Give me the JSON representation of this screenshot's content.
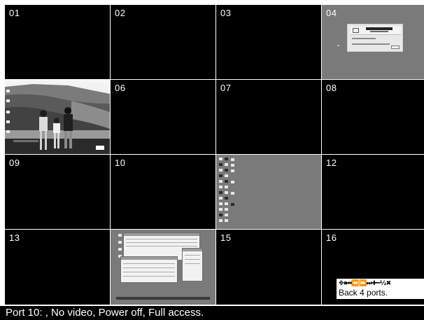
{
  "tiles": [
    {
      "label": "01",
      "background": "#000000"
    },
    {
      "label": "02",
      "background": "#000000"
    },
    {
      "label": "03",
      "background": "#000000"
    },
    {
      "label": "04",
      "background": "#7a7a7a"
    },
    {
      "label": "",
      "background": "photo"
    },
    {
      "label": "06",
      "background": "#000000"
    },
    {
      "label": "07",
      "background": "#000000"
    },
    {
      "label": "08",
      "background": "#000000"
    },
    {
      "label": "09",
      "background": "#000000"
    },
    {
      "label": "10",
      "background": "#000000"
    },
    {
      "label": "",
      "background": "#7a7a7a"
    },
    {
      "label": "12",
      "background": "#000000"
    },
    {
      "label": "13",
      "background": "#000000"
    },
    {
      "label": "",
      "background": "#7a7a7a"
    },
    {
      "label": "15",
      "background": "#000000"
    },
    {
      "label": "16",
      "background": "#000000"
    }
  ],
  "osd": {
    "controls": [
      {
        "icon": "move-icon",
        "glyph": "✥"
      },
      {
        "icon": "pause-icon",
        "glyph": "⏸"
      },
      {
        "icon": "skip-first-icon",
        "glyph": "⏮"
      },
      {
        "icon": "rewind-icon",
        "glyph": "⏪"
      },
      {
        "icon": "fast-forward-icon",
        "glyph": "⏩"
      },
      {
        "icon": "skip-last-icon",
        "glyph": "⏭"
      },
      {
        "icon": "plus-icon",
        "glyph": "✚"
      },
      {
        "icon": "minus-icon",
        "glyph": "━"
      },
      {
        "icon": "fraction-icon",
        "glyph": "½"
      },
      {
        "icon": "close-icon",
        "glyph": "✖"
      }
    ],
    "message": "Back 4 ports."
  },
  "status": {
    "text": "Port 10: , No video, Power off, Full access."
  }
}
